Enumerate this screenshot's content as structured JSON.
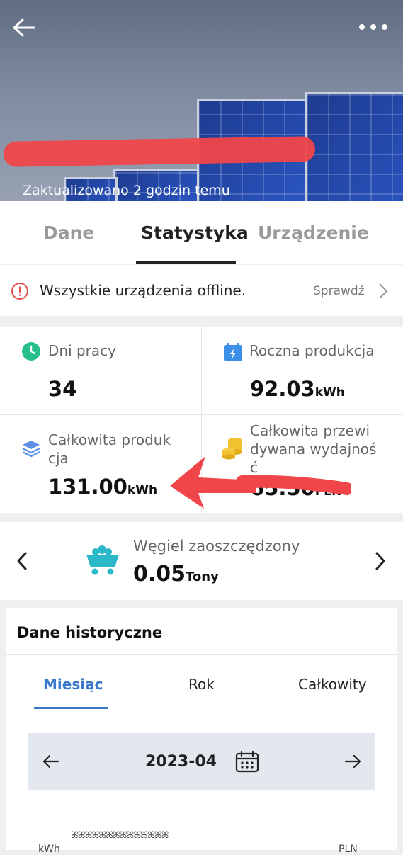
{
  "header": {
    "updated_text": "Zaktualizowano 2 godzin temu"
  },
  "tabs": [
    "Dane",
    "Statystyka",
    "Urządzenie"
  ],
  "alert": {
    "message": "Wszystkie urządzenia offline.",
    "action_label": "Sprawdź"
  },
  "stats": {
    "work_days": {
      "label": "Dni pracy",
      "value": "34"
    },
    "yearly_production": {
      "label": "Roczna produkcja",
      "value": "92.03",
      "unit": "kWh"
    },
    "total_production": {
      "label_line1": "Całkowita produk",
      "label_line2": "cja",
      "value": "131.00",
      "unit": "kWh"
    },
    "total_yield": {
      "label_line1": "Całkowita przewi",
      "label_line2": "dywana wydajnoś",
      "label_line3": "ć",
      "value": "65.50",
      "unit": "PLN"
    }
  },
  "coal": {
    "label": "Węgiel zaoszczędzony",
    "value": "0.05",
    "unit": "Tony"
  },
  "history": {
    "title": "Dane historyczne",
    "tabs": [
      "Miesiąc",
      "Rok",
      "Całkowity"
    ],
    "date": "2023-04",
    "axis_left_unit": "kWh",
    "axis_right_unit": "PLN",
    "legend_icons": "ꕤꕤꕤꕤꕤꕤꕤꕤꕤꕤꕤꕤꕤꕤ"
  },
  "colors": {
    "accent": "#3a78c9",
    "alert": "#e2504c",
    "coal_icon": "#2bb8c9",
    "coin_icon": "#f2c12e",
    "clock_icon": "#27c08a",
    "calendar_icon": "#3b8fe6",
    "redaction": "#f0464a"
  }
}
